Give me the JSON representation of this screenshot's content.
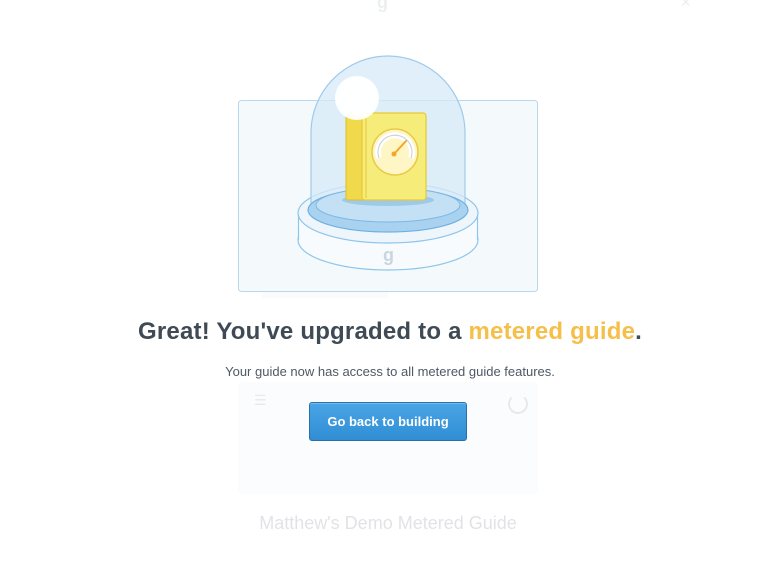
{
  "background": {
    "logo_letter": "g",
    "close_glyph": "✕",
    "card_menu_glyph": "☰",
    "guide_title": "Matthew's Demo Metered Guide"
  },
  "illustration": {
    "icon_name": "metered-guide-book-under-glass-dome-icon",
    "pedestal_letter": "g",
    "colors": {
      "dome": "#d6eaf8",
      "book": "#f6ec7a",
      "pedestal": "#8ec5ea",
      "gauge_needle": "#f5bf4a"
    }
  },
  "message": {
    "headline_prefix": "Great! You've upgraded to a ",
    "headline_accent": "metered guide",
    "headline_suffix": ".",
    "subtext": "Your guide now has access to all metered guide features."
  },
  "actions": {
    "back_label": "Go back to building"
  },
  "colors": {
    "accent": "#f5bf4a",
    "primary_button": "#3a98dc",
    "heading_text": "#3f4a55"
  }
}
